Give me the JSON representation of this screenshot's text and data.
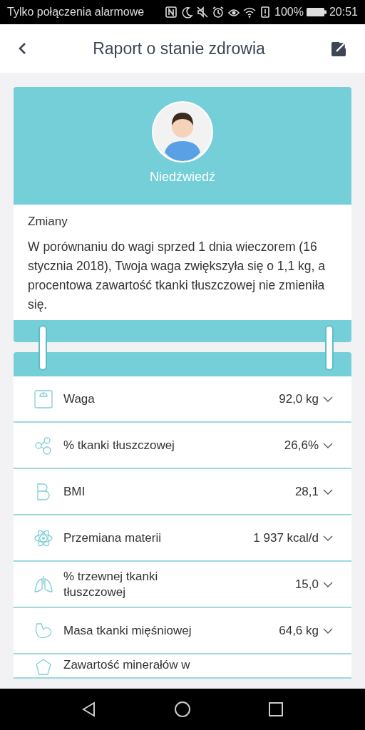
{
  "status_bar": {
    "carrier": "Tylko połączenia alarmowe",
    "battery": "100%",
    "time": "20:51"
  },
  "header": {
    "title": "Raport o stanie zdrowia"
  },
  "profile": {
    "name": "Niedźwiedź"
  },
  "changes": {
    "heading": "Zmiany",
    "text": "W porównaniu do wagi sprzed 1 dnia wieczorem (16 stycznia 2018), Twoja waga zwiększyła się o 1,1 kg, a procentowa zawartość tkanki tłuszczowej nie zmieniła się."
  },
  "metrics": [
    {
      "kind": "scale",
      "label": "Waga",
      "value": "92,0 kg"
    },
    {
      "kind": "bubbles",
      "label": "% tkanki tłuszczowej",
      "value": "26,6%"
    },
    {
      "kind": "bmi",
      "label": "BMI",
      "value": "28,1"
    },
    {
      "kind": "atom",
      "label": "Przemiana materii",
      "value": "1 937 kcal/d"
    },
    {
      "kind": "lungs",
      "label": "% trzewnej tkanki tłuszczowej",
      "value": "15,0"
    },
    {
      "kind": "muscle",
      "label": "Masa tkanki mięśniowej",
      "value": "64,6 kg"
    },
    {
      "kind": "mineral",
      "label": "Zawartość minerałów w"
    }
  ]
}
